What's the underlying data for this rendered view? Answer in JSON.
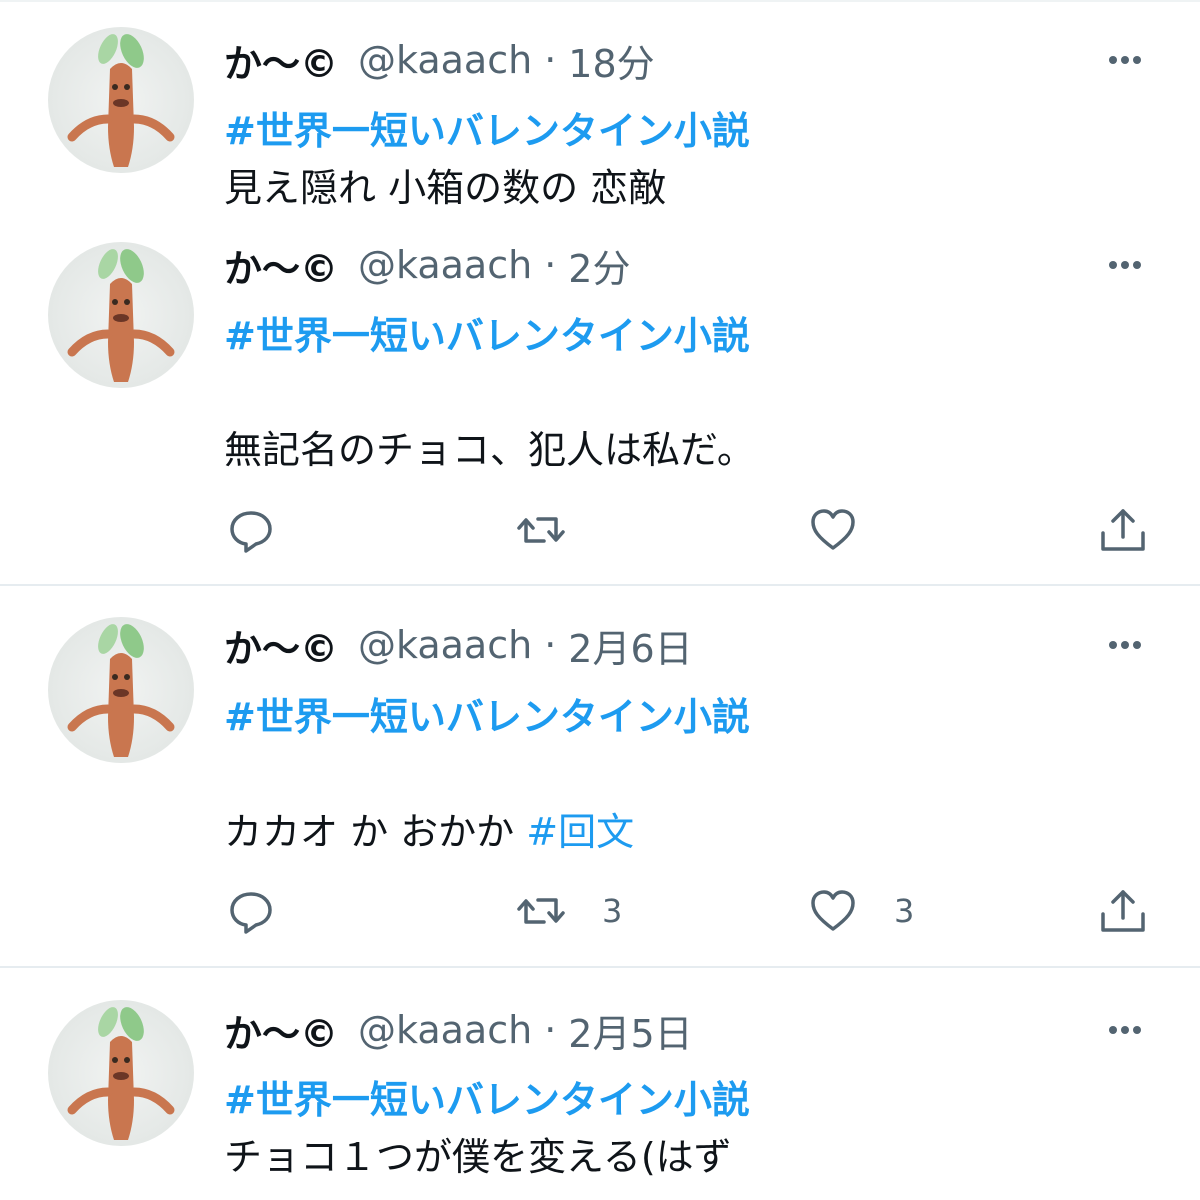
{
  "tweets": [
    {
      "name": "か〜©",
      "handle": "@kaaach",
      "separator": "·",
      "time": "18分",
      "hashtag": "#世界一短いバレンタイン小説",
      "text": "見え隠れ 小箱の数の 恋敵"
    },
    {
      "name": "か〜©",
      "handle": "@kaaach",
      "separator": "·",
      "time": "2分",
      "hashtag": "#世界一短いバレンタイン小説",
      "text": "無記名のチョコ、犯人は私だ。",
      "retweets": "",
      "likes": ""
    },
    {
      "name": "か〜©",
      "handle": "@kaaach",
      "separator": "·",
      "time": "2月6日",
      "hashtag": "#世界一短いバレンタイン小説",
      "text": "カカオ か おかか ",
      "inline_hashtag": "#回文",
      "retweets": "3",
      "likes": "3"
    },
    {
      "name": "か〜©",
      "handle": "@kaaach",
      "separator": "·",
      "time": "2月5日",
      "hashtag": "#世界一短いバレンタイン小説",
      "text": "チョコ１つが僕を変える(はず"
    }
  ],
  "icons": {
    "more": "more-horizontal-icon",
    "reply": "reply-icon",
    "retweet": "retweet-icon",
    "like": "heart-icon",
    "share": "share-icon"
  },
  "colors": {
    "hashtag": "#1d9bf0",
    "secondary_text": "#536471",
    "primary_text": "#0f1419",
    "divider": "#e6ecf0"
  }
}
